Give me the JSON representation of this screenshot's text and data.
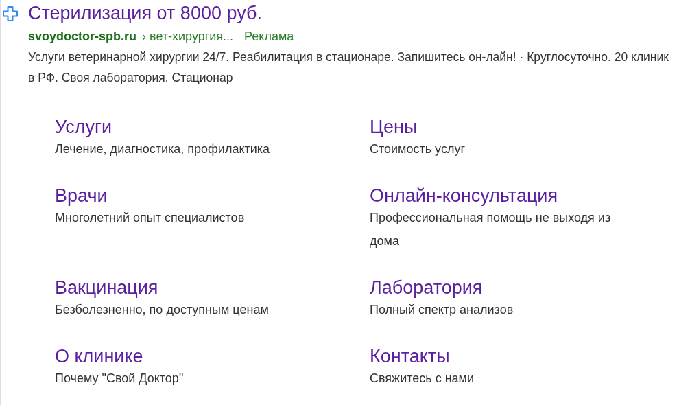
{
  "ad": {
    "title": "Стерилизация от 8000 руб.",
    "domain": "svoydoctor-spb.ru",
    "breadcrumb": "› вет-хирургия...",
    "ad_label": "Реклама",
    "description": "Услуги ветеринарной хирургии 24/7. Реабилитация в стационаре. Запишитесь он-лайн! · Круглосуточно. 20 клиник в РФ. Своя лаборатория. Стационар"
  },
  "sitelinks": [
    {
      "title": "Услуги",
      "description": "Лечение, диагностика, профилактика"
    },
    {
      "title": "Цены",
      "description": "Стоимость услуг"
    },
    {
      "title": "Врачи",
      "description": "Многолетний опыт специалистов"
    },
    {
      "title": "Онлайн-консультация",
      "description": "Профессиональная помощь не выходя из дома"
    },
    {
      "title": "Вакцинация",
      "description": "Безболезненно, по доступным ценам"
    },
    {
      "title": "Лаборатория",
      "description": "Полный спектр анализов"
    },
    {
      "title": "О клинике",
      "description": "Почему \"Свой Доктор\""
    },
    {
      "title": "Контакты",
      "description": "Свяжитесь с нами"
    }
  ]
}
